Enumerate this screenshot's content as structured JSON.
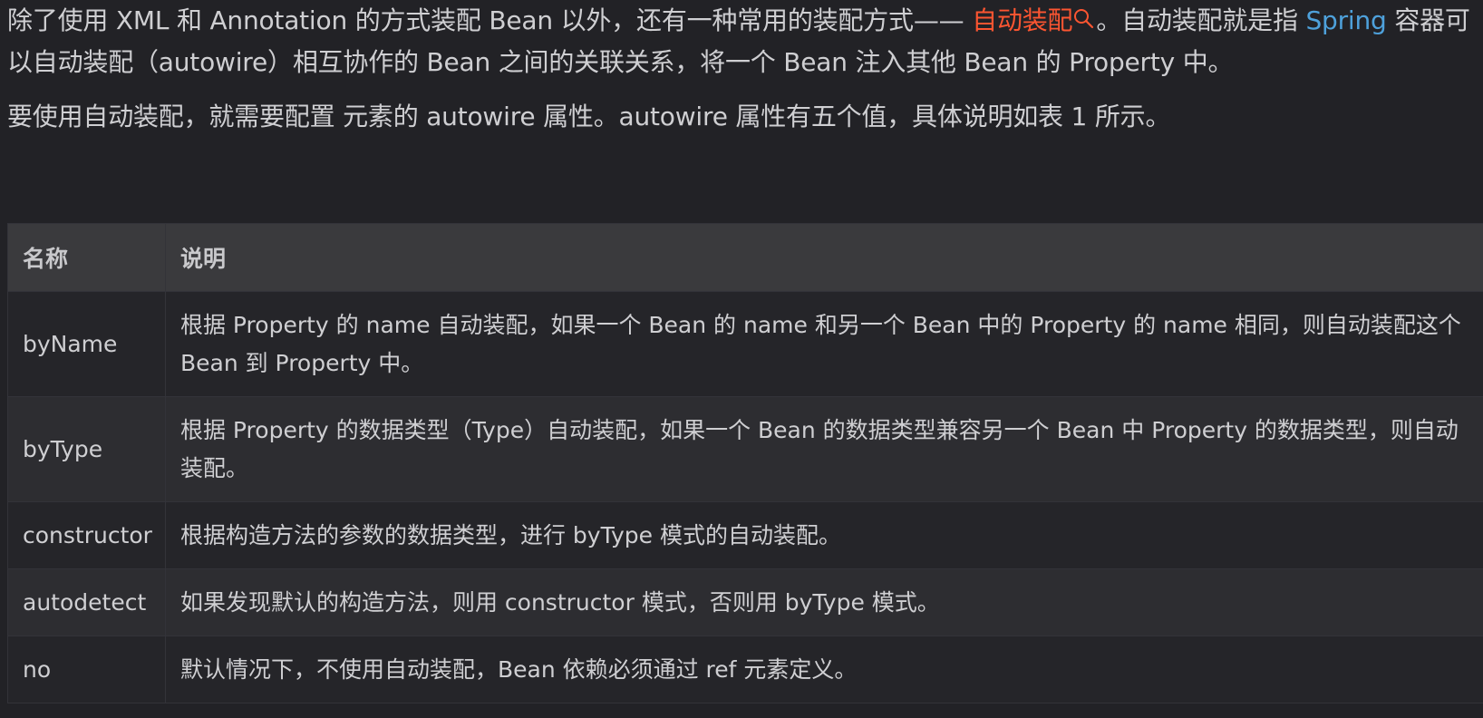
{
  "intro": {
    "p1_a": "除了使用 XML 和 Annotation 的方式装配 Bean 以外，还有一种常用的装配方式—— ",
    "p1_highlight": "自动装配",
    "p1_b": "。自动装配就是指 ",
    "p1_link": "Spring",
    "p1_c": " 容器可以自动装配（autowire）相互协作的 Bean 之间的关联关系，将一个 Bean 注入其他 Bean 的 Property 中。",
    "p2": "要使用自动装配，就需要配置 元素的 autowire 属性。autowire 属性有五个值，具体说明如表 1 所示。"
  },
  "icons": {
    "highlight_icon": "search-icon"
  },
  "colors": {
    "highlight": "#fc5531",
    "link": "#4ea1db",
    "background": "#222226"
  },
  "table": {
    "headers": [
      "名称",
      "说明"
    ],
    "rows": [
      {
        "name": "byName",
        "desc": "根据 Property 的 name 自动装配，如果一个 Bean 的 name 和另一个 Bean 中的 Property 的 name 相同，则自动装配这个 Bean 到 Property 中。"
      },
      {
        "name": "byType",
        "desc": "根据 Property 的数据类型（Type）自动装配，如果一个 Bean 的数据类型兼容另一个 Bean 中 Property 的数据类型，则自动装配。"
      },
      {
        "name": "constructor",
        "desc": "根据构造方法的参数的数据类型，进行 byType 模式的自动装配。"
      },
      {
        "name": "autodetect",
        "desc": "如果发现默认的构造方法，则用 constructor 模式，否则用 byType 模式。"
      },
      {
        "name": "no",
        "desc": "默认情况下，不使用自动装配，Bean 依赖必须通过 ref 元素定义。"
      }
    ]
  }
}
